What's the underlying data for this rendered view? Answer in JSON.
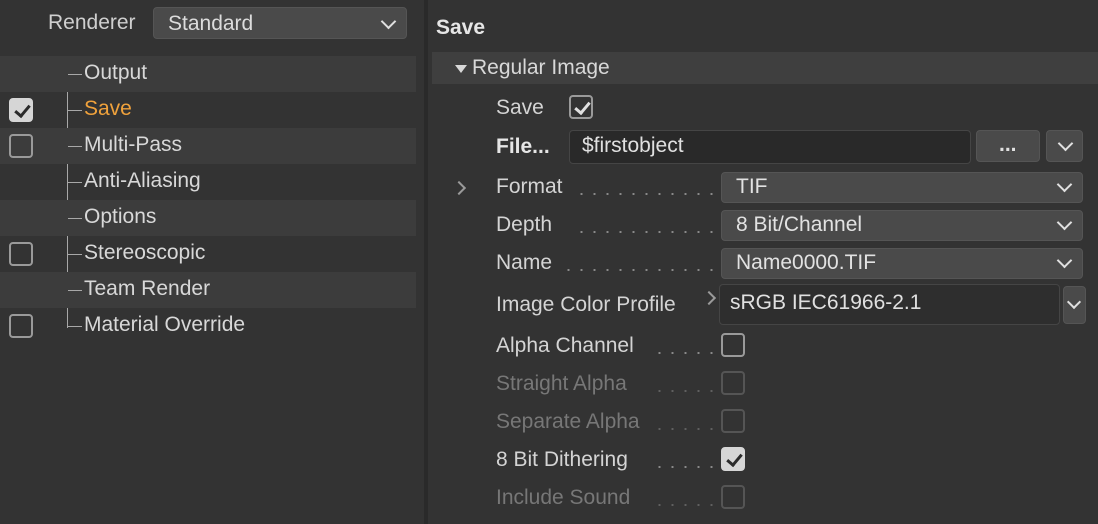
{
  "renderer": {
    "label": "Renderer",
    "value": "Standard"
  },
  "tree": [
    {
      "label": "Output",
      "checkbox": "none",
      "active": false
    },
    {
      "label": "Save",
      "checkbox": "checked",
      "active": true
    },
    {
      "label": "Multi-Pass",
      "checkbox": "unchecked",
      "active": false
    },
    {
      "label": "Anti-Aliasing",
      "checkbox": "none",
      "active": false
    },
    {
      "label": "Options",
      "checkbox": "none",
      "active": false
    },
    {
      "label": "Stereoscopic",
      "checkbox": "unchecked",
      "active": false
    },
    {
      "label": "Team Render",
      "checkbox": "none",
      "active": false
    },
    {
      "label": "Material Override",
      "checkbox": "unchecked",
      "active": false
    }
  ],
  "panel": {
    "title": "Save",
    "group": "Regular Image",
    "save_label": "Save",
    "save_checked": true,
    "file_label": "File...",
    "file_value": "$firstobject",
    "browse_label": "...",
    "format_label": "Format",
    "format_value": "TIF",
    "depth_label": "Depth",
    "depth_value": "8 Bit/Channel",
    "name_label": "Name",
    "name_value": "Name0000.TIF",
    "profile_label": "Image Color Profile",
    "profile_value": "sRGB IEC61966-2.1",
    "alpha_label": "Alpha Channel",
    "alpha_checked": false,
    "straight_label": "Straight Alpha",
    "straight_checked": false,
    "separate_label": "Separate Alpha",
    "separate_checked": false,
    "dither_label": "8 Bit Dithering",
    "dither_checked": true,
    "sound_label": "Include Sound",
    "sound_checked": false
  },
  "colors": {
    "accent": "#f0a23c",
    "background": "#333333"
  }
}
